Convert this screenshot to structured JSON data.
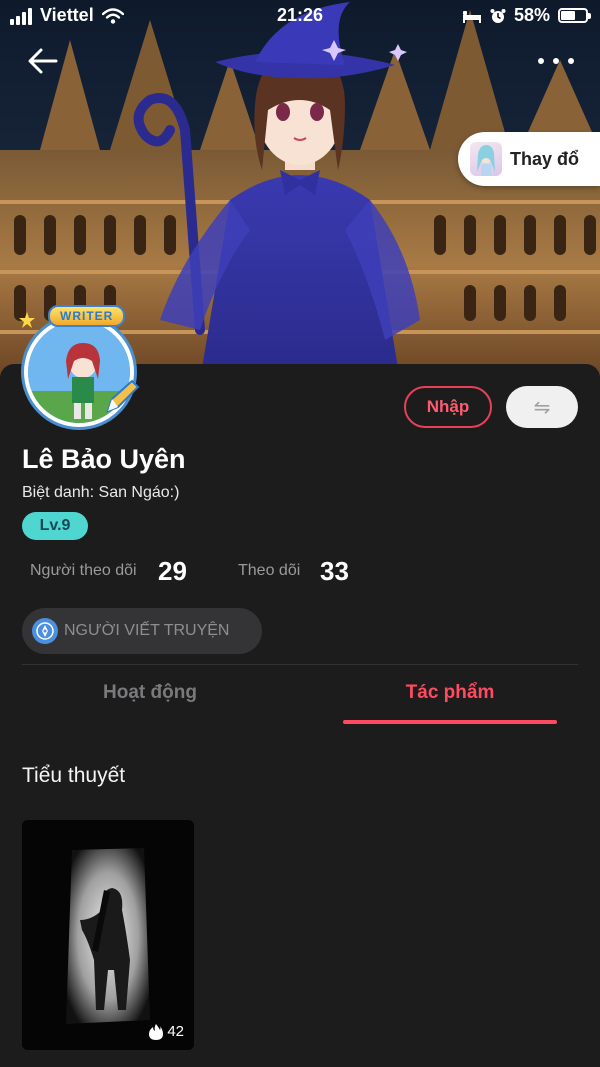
{
  "status_bar": {
    "carrier": "Viettel",
    "time": "21:26",
    "battery": "58%",
    "battery_level": 0.58
  },
  "header": {
    "change_button_label": "Thay đổ"
  },
  "profile": {
    "writer_tag": "WRITER",
    "name": "Lê Bảo Uyên",
    "nickname_label": "Biệt danh:",
    "nickname_value": "San Ngáo:)",
    "level": "Lv.9",
    "import_button": "Nhập",
    "swap_icon": "⇋",
    "followers_label": "Người theo dõi",
    "followers_count": "29",
    "following_label": "Theo dõi",
    "following_count": "33",
    "role_badge": "NGƯỜI VIẾT TRUYỆN"
  },
  "tabs": [
    {
      "label": "Hoạt động",
      "active": false
    },
    {
      "label": "Tác phẩm",
      "active": true
    }
  ],
  "works": {
    "section_title": "Tiểu thuyết",
    "items": [
      {
        "views": "42",
        "icon": "fire-icon"
      }
    ]
  },
  "colors": {
    "background": "#1c1c1d",
    "accent": "#ff4a60",
    "level_badge": "#4fd6d0",
    "muted_text": "#9a9a9a"
  }
}
